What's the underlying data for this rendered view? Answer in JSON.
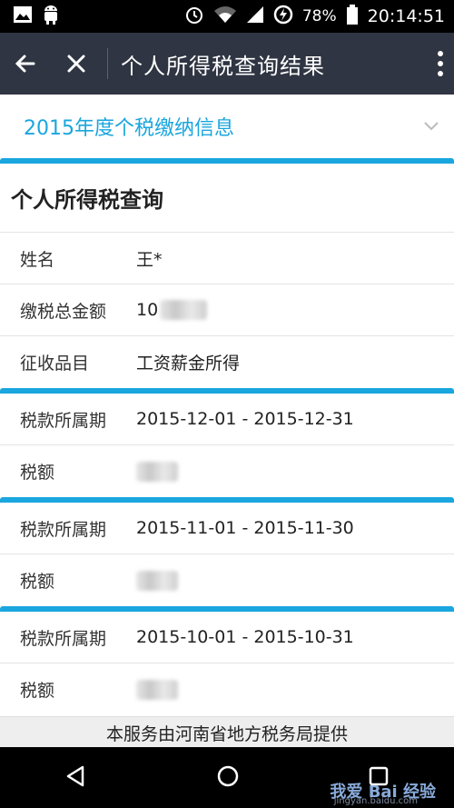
{
  "status_bar": {
    "battery": "78%",
    "time": "20:14:51",
    "icons": [
      "image-icon",
      "android-icon",
      "alarm-icon",
      "wifi-icon",
      "signal-icon",
      "data-saver-icon",
      "battery-icon"
    ]
  },
  "app_bar": {
    "title": "个人所得税查询结果"
  },
  "year_section": {
    "label": "2015年度个税缴纳信息"
  },
  "section": {
    "title": "个人所得税查询"
  },
  "summary": [
    {
      "label": "姓名",
      "value": "王*"
    },
    {
      "label": "缴税总金额",
      "value": "10"
    },
    {
      "label": "征收品目",
      "value": "工资薪金所得"
    }
  ],
  "periods": [
    {
      "period_label": "税款所属期",
      "period_value": "2015-12-01 - 2015-12-31",
      "amount_label": "税额"
    },
    {
      "period_label": "税款所属期",
      "period_value": "2015-11-01 - 2015-11-30",
      "amount_label": "税额"
    },
    {
      "period_label": "税款所属期",
      "period_value": "2015-10-01 - 2015-10-31",
      "amount_label": "税额"
    }
  ],
  "footer": {
    "text": "本服务由河南省地方税务局提供"
  },
  "watermark": {
    "text": "我爱 Bai 经验",
    "url": "jingyan.baidu.com"
  },
  "colors": {
    "accent": "#1aa6de",
    "app_bar": "#2f3542"
  }
}
